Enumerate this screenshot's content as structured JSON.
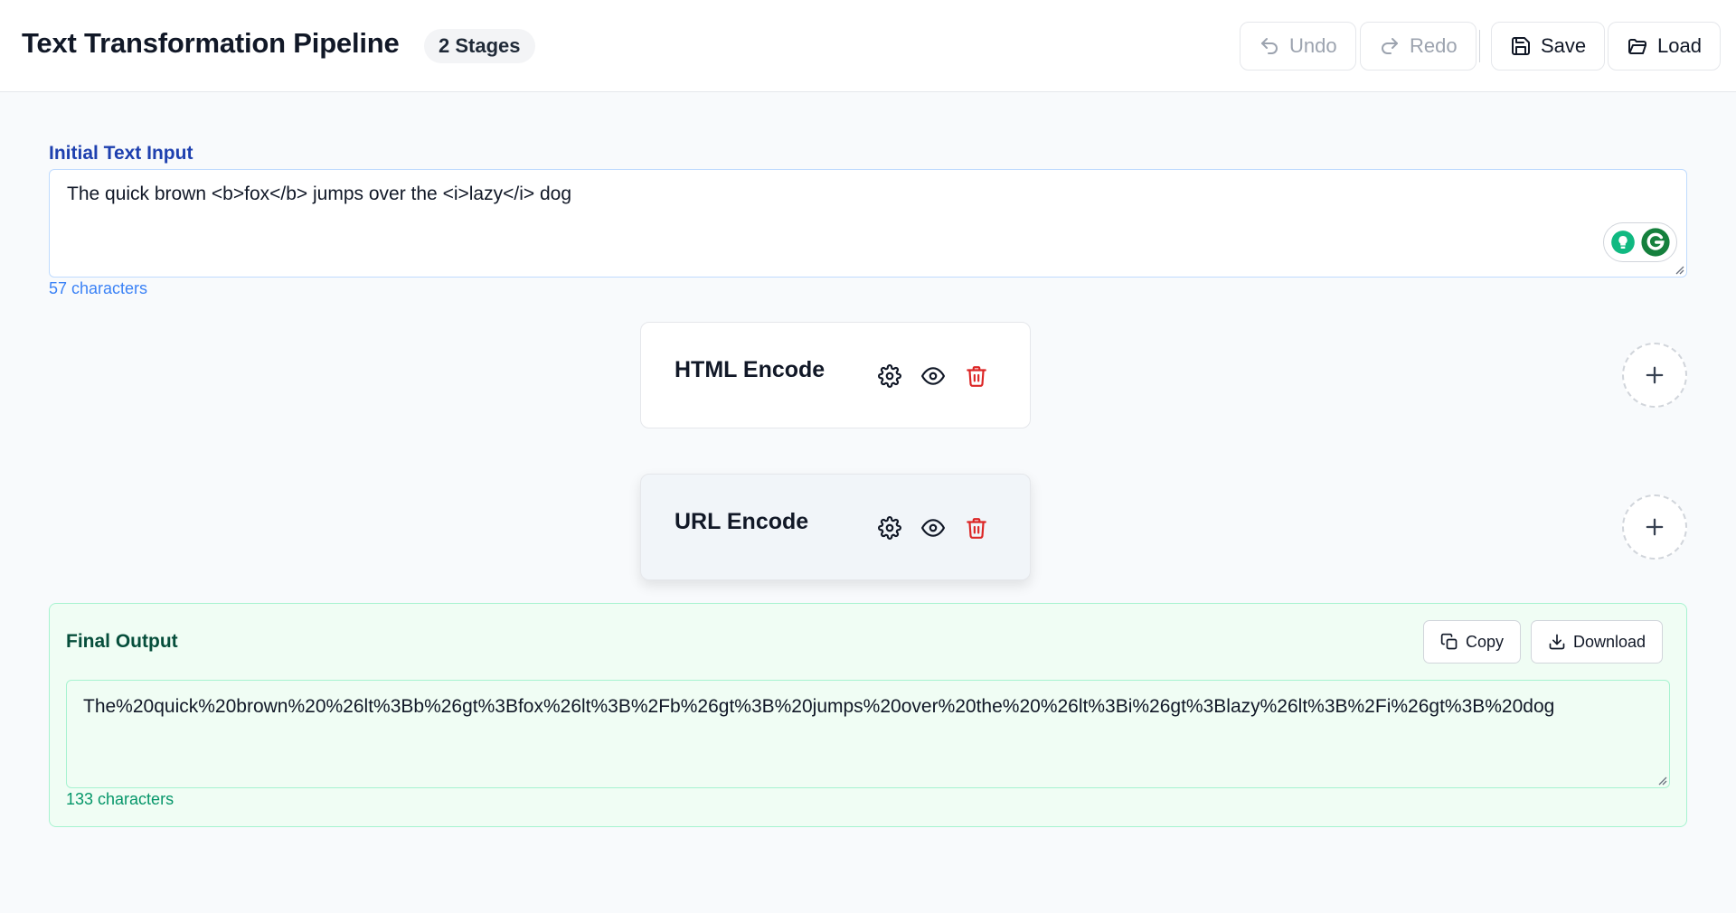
{
  "header": {
    "title": "Text Transformation Pipeline",
    "stage_badge": "2 Stages",
    "buttons": {
      "undo": "Undo",
      "redo": "Redo",
      "save": "Save",
      "load": "Load"
    }
  },
  "input": {
    "label": "Initial Text Input",
    "value": "The quick brown <b>fox</b> jumps over the <i>lazy</i> dog",
    "char_count": "57 characters"
  },
  "stages": [
    {
      "name": "HTML Encode",
      "icons": [
        "gear-icon",
        "eye-icon",
        "trash-icon"
      ]
    },
    {
      "name": "URL Encode",
      "icons": [
        "gear-icon",
        "eye-icon",
        "trash-icon"
      ]
    }
  ],
  "output": {
    "title": "Final Output",
    "copy_label": "Copy",
    "download_label": "Download",
    "value": "The%20quick%20brown%20%26lt%3Bb%26gt%3Bfox%26lt%3B%2Fb%26gt%3B%20jumps%20over%20the%20%26lt%3Bi%26gt%3Blazy%26lt%3B%2Fi%26gt%3B%20dog",
    "char_count": "133 characters"
  },
  "colors": {
    "accent_blue": "#1e40af",
    "delete_red": "#dc2626",
    "success_green": "#059669"
  }
}
